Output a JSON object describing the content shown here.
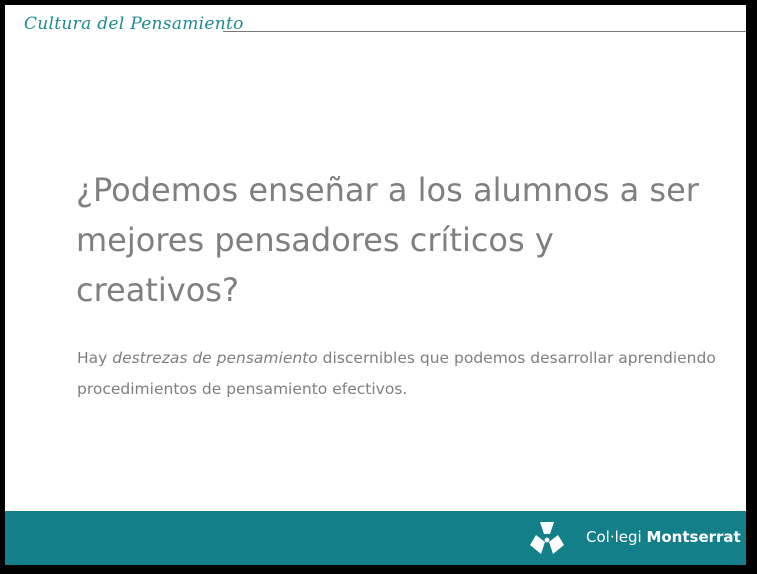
{
  "header": {
    "title": "Cultura del Pensamiento"
  },
  "slide": {
    "heading": "¿Podemos enseñar a los alumnos a ser mejores pensadores críticos y creativos?",
    "body_prefix": "Hay ",
    "body_emphasis": "destrezas de pensamiento",
    "body_suffix": " discernibles que podemos desarrollar aprendiendo procedimientos de pensamiento efectivos."
  },
  "footer": {
    "school_prefix": "Col·legi ",
    "school_name": "Montserrat",
    "logo_icon": "montserrat-logo-icon"
  },
  "colors": {
    "accent": "#1c8a92",
    "footer_band": "#137f88",
    "text_gray": "#7f7f7f",
    "frame": "#000000"
  }
}
